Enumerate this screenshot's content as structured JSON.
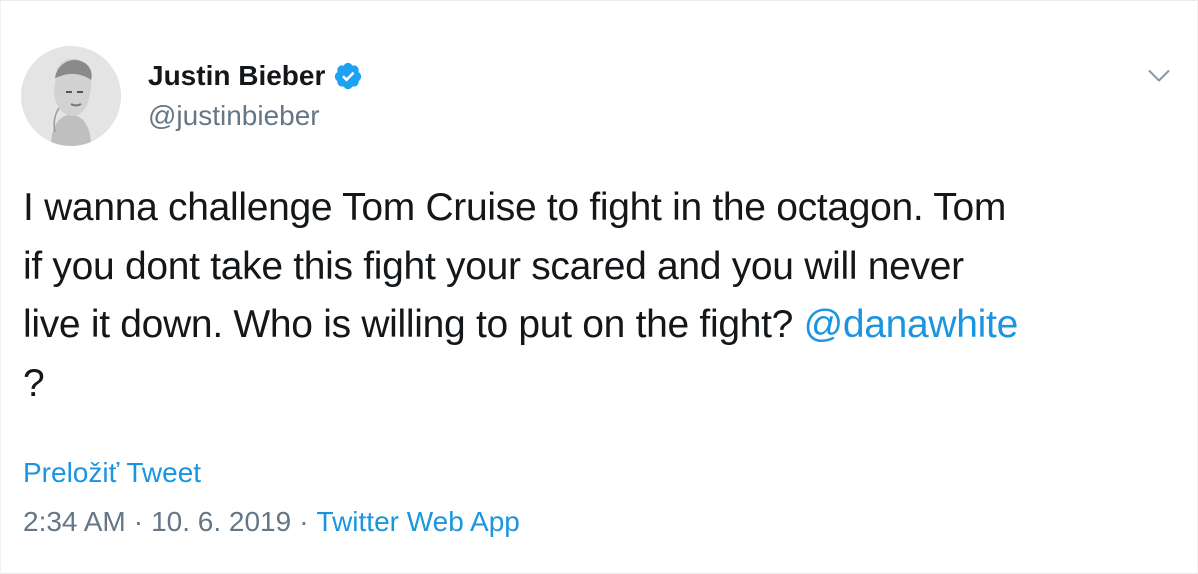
{
  "author": {
    "display_name": "Justin Bieber",
    "username": "@justinbieber",
    "verified": true
  },
  "tweet": {
    "lines": [
      "I wanna challenge Tom Cruise to fight in the octagon. Tom",
      "if you dont take this fight your scared and you will never",
      "live it down. Who is willing to put on the fight? "
    ],
    "mention": "@danawhite",
    "tail": "?"
  },
  "translate_label": "Preložiť Tweet",
  "meta": {
    "time": "2:34 AM",
    "separator": "·",
    "date": "10. 6. 2019",
    "source": "Twitter Web App"
  },
  "colors": {
    "link": "#1b95e0",
    "secondary_text": "#657786",
    "primary_text": "#14171a",
    "verified": "#1da1f2"
  },
  "icons": {
    "verified": "verified-badge-icon",
    "more": "chevron-down-icon"
  }
}
